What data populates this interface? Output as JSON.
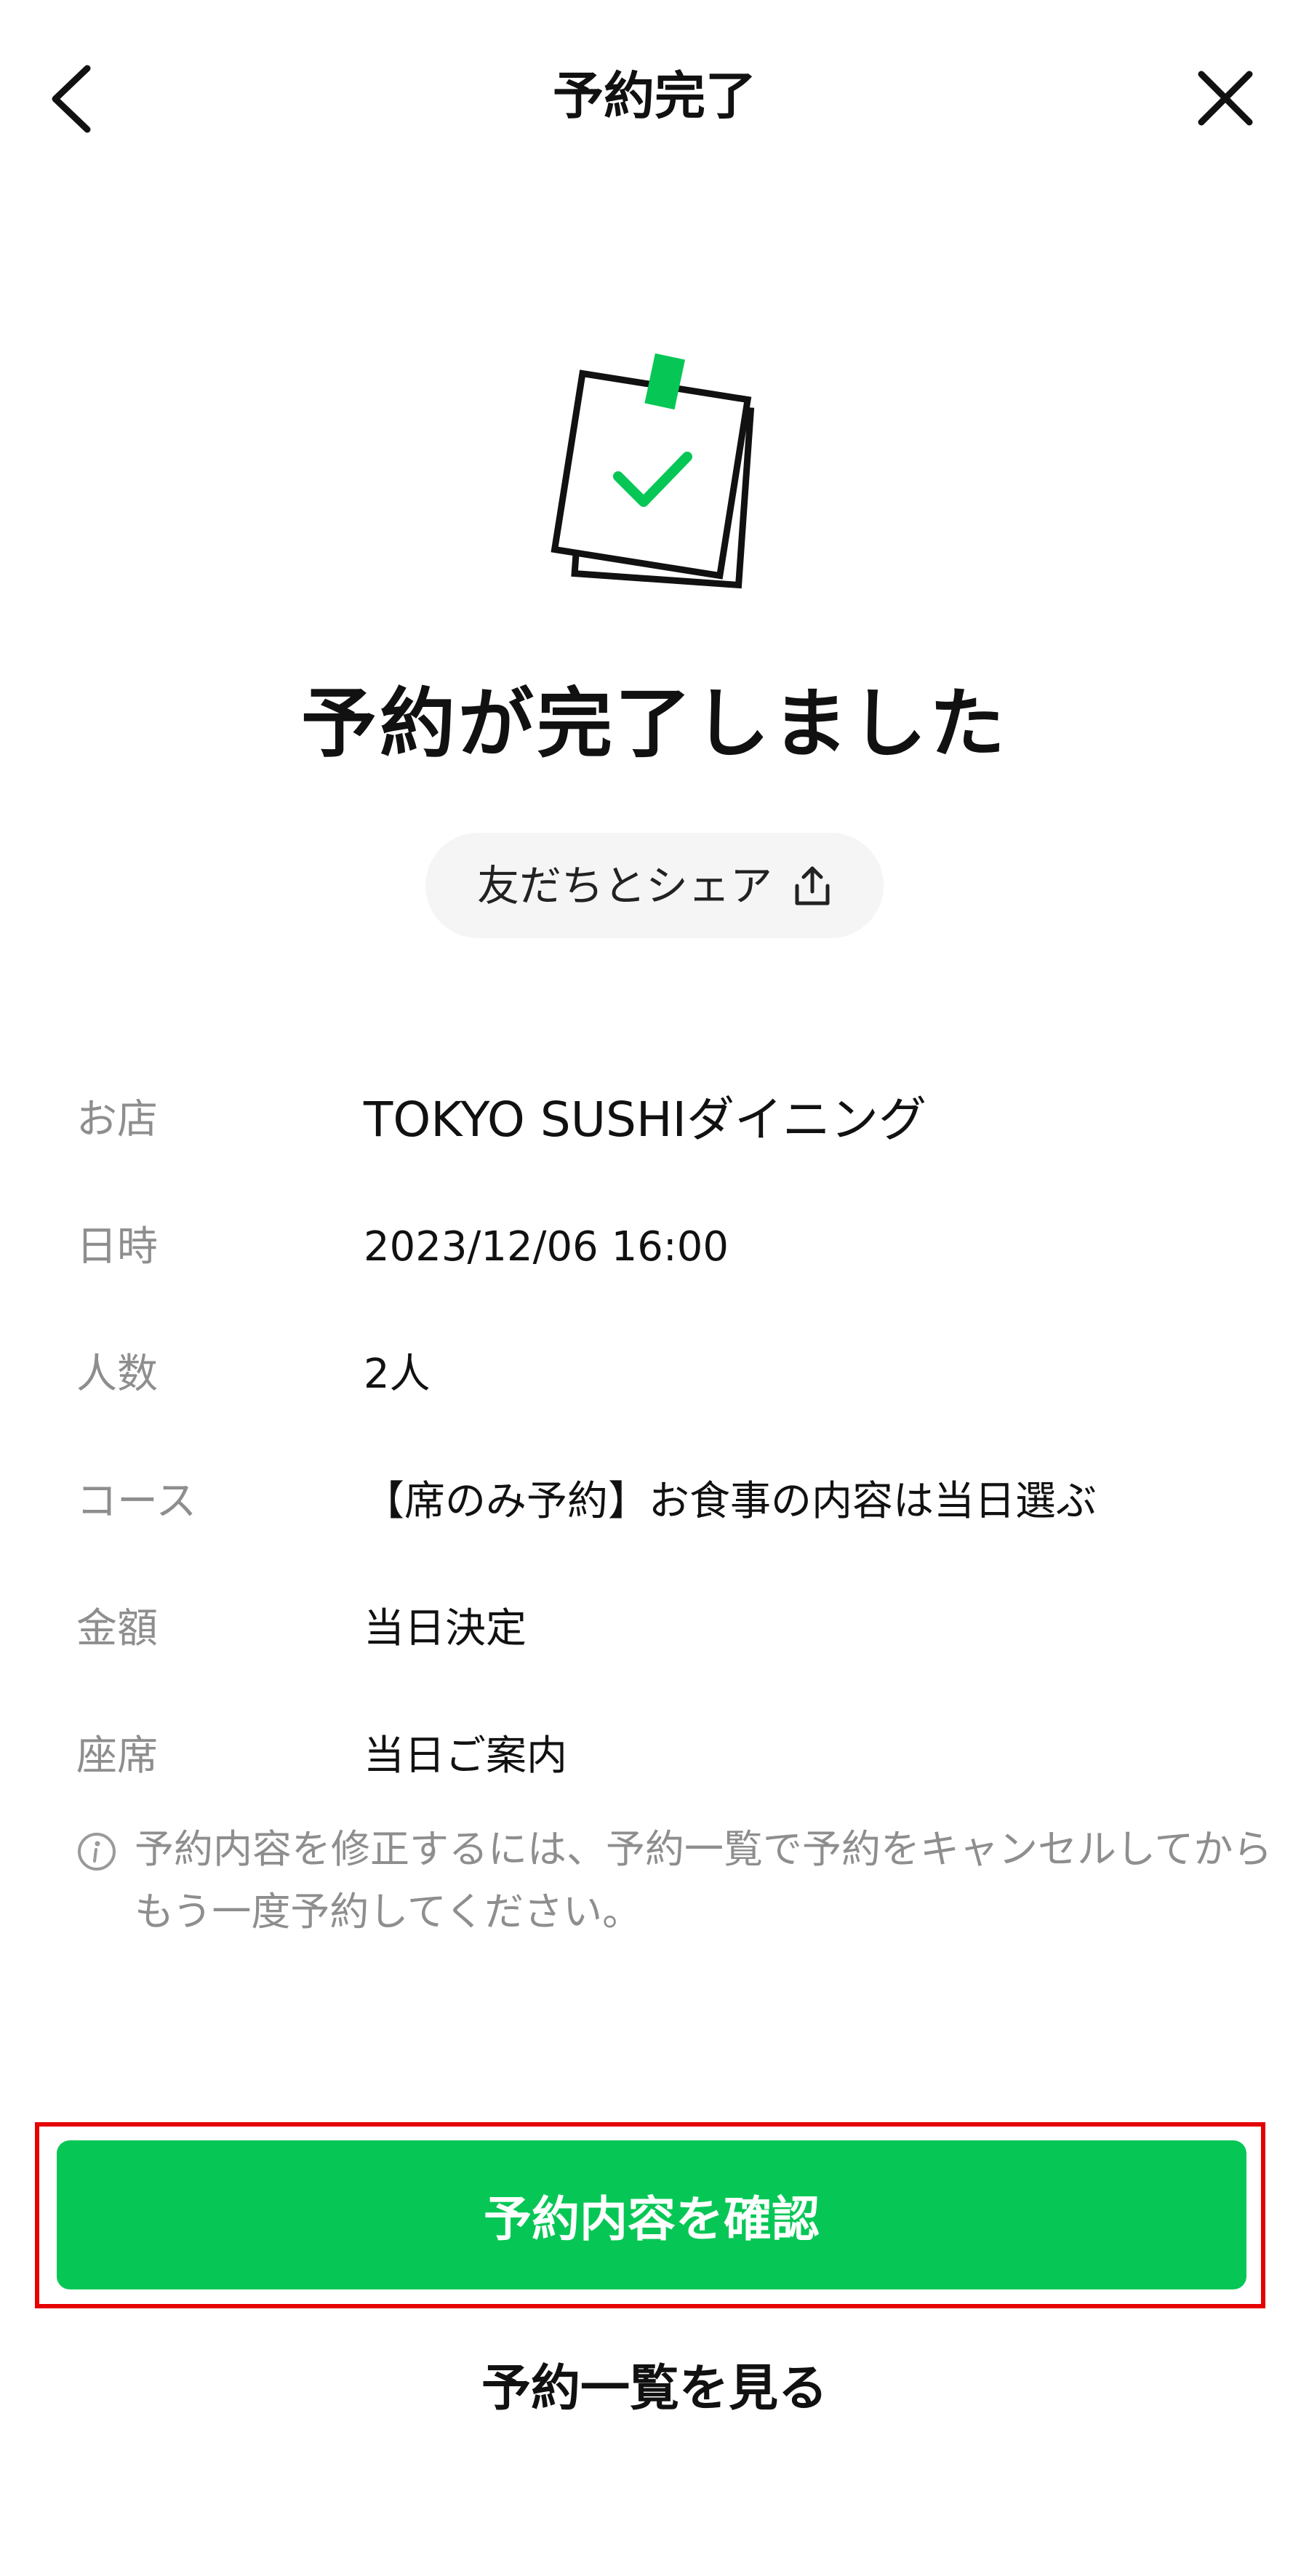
{
  "header": {
    "title": "予約完了",
    "back_icon": "chevron-left-icon",
    "close_icon": "close-icon"
  },
  "illustration": {
    "icon": "checked-note-icon",
    "accent_color": "#06c755"
  },
  "completion": {
    "title": "予約が完了しました",
    "share_label": "友だちとシェア",
    "share_icon": "share-icon"
  },
  "details": {
    "rows": [
      {
        "label": "お店",
        "value": "TOKYO SUSHIダイニング"
      },
      {
        "label": "日時",
        "value": "2023/12/06 16:00"
      },
      {
        "label": "人数",
        "value": "2人"
      },
      {
        "label": "コース",
        "value": "【席のみ予約】お食事の内容は当日選ぶ"
      },
      {
        "label": "金額",
        "value": "当日決定"
      },
      {
        "label": "座席",
        "value": "当日ご案内"
      }
    ]
  },
  "notice": {
    "icon": "info-icon",
    "text": "予約内容を修正するには、予約一覧で予約をキャンセルしてからもう一度予約してください。"
  },
  "actions": {
    "confirm_label": "予約内容を確認",
    "list_label": "予約一覧を見る",
    "primary_color": "#06c755",
    "highlight_color": "#e60000"
  }
}
